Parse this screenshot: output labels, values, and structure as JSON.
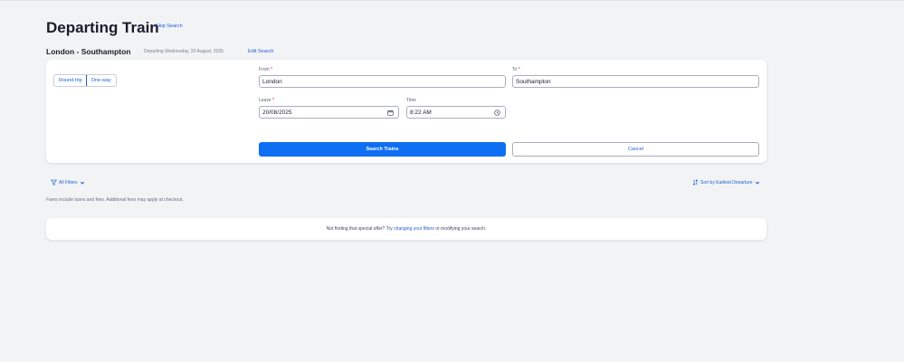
{
  "page": {
    "title": "Departing Train",
    "skip_link": "Skip Search"
  },
  "journey": {
    "route": "London - Southampton",
    "departing": "Departing Wednesday, 20 August, 2025",
    "edit_link": "Edit Search"
  },
  "trip_type": {
    "options": [
      "Round-trip",
      "One-way"
    ],
    "selected": "One-way"
  },
  "form": {
    "from": {
      "label": "From",
      "value": "London"
    },
    "to": {
      "label": "To",
      "value": "Southampton"
    },
    "leave": {
      "label": "Leave",
      "value": "20/08/2025",
      "icon": "calendar-icon"
    },
    "time": {
      "label": "Time",
      "value": "8:22 AM",
      "icon": "clock-icon"
    },
    "required_marker": "*",
    "search_button": "Search Trains",
    "cancel_button": "Cancel"
  },
  "toolbar": {
    "filters_label": "All Filters",
    "sort_label": "Sort by Earliest Departure"
  },
  "fares_note": "Fares include taxes and fees. Additional fees may apply at checkout.",
  "notice": {
    "before": "Not finding that special offer? Try",
    "link": "changing your filters",
    "after": "or modifying your search."
  },
  "colors": {
    "accent": "#1f5fd8",
    "primary_button": "#0f6ff2",
    "required": "#d01919",
    "background": "#f2f3f5"
  }
}
